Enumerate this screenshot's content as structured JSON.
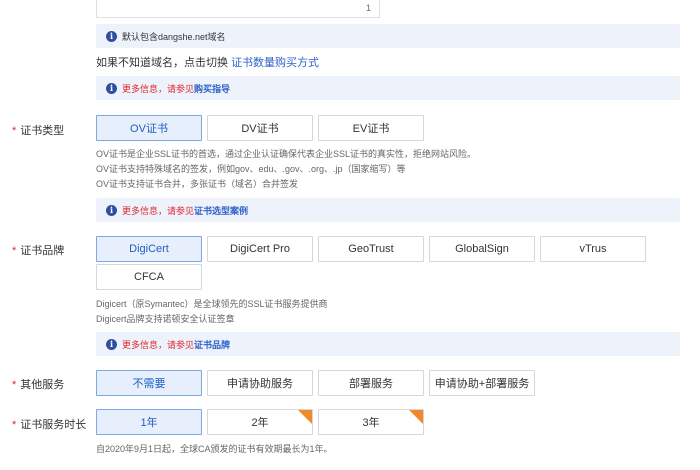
{
  "domain_count": {
    "value": "1"
  },
  "info_default_domain": "默认包含dangshe.net域名",
  "switch_hint": {
    "text": "如果不知道域名，点击切换",
    "link": "证书数量购买方式"
  },
  "info_buy_guide": {
    "red": "更多信息，请参见",
    "link": "购买指导"
  },
  "cert_type": {
    "label": "证书类型",
    "options": [
      "OV证书",
      "DV证书",
      "EV证书"
    ],
    "selected": "OV证书",
    "desc": [
      "OV证书是企业SSL证书的首选，通过企业认证确保代表企业SSL证书的真实性，拒绝网站风险。",
      "OV证书支持特殊域名的签发，例如gov、edu、.gov、.org、.jp（国家缩写）等",
      "OV证书支持证书合并，多张证书（域名）合并签发"
    ],
    "info": {
      "red": "更多信息，请参见",
      "link": "证书选型案例"
    }
  },
  "cert_brand": {
    "label": "证书品牌",
    "options": [
      "DigiCert",
      "DigiCert Pro",
      "GeoTrust",
      "GlobalSign",
      "vTrus",
      "CFCA"
    ],
    "selected": "DigiCert",
    "desc": [
      "Digicert（原Symantec）是全球领先的SSL证书服务提供商",
      "Digicert品牌支持诺顿安全认证签章"
    ],
    "info": {
      "red": "更多信息，请参见",
      "link": "证书品牌"
    }
  },
  "other_service": {
    "label": "其他服务",
    "options": [
      "不需要",
      "申请协助服务",
      "部署服务",
      "申请协助+部署服务"
    ],
    "selected": "不需要"
  },
  "service_duration": {
    "label": "证书服务时长",
    "options": [
      "1年",
      "2年",
      "3年"
    ],
    "selected": "1年",
    "desc": [
      "自2020年9月1日起，全球CA颁发的证书有效期最长为1年。"
    ]
  },
  "colors": {
    "accent": "#1f5fc4",
    "red": "#e0262c",
    "info_bg": "#eef3fb",
    "hot_badge": "#f08a2a"
  }
}
